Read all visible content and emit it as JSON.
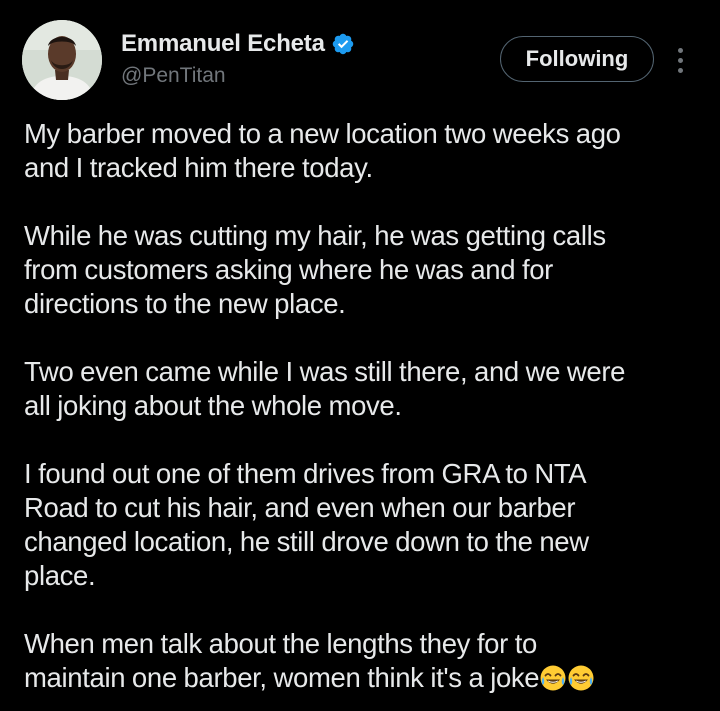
{
  "author": {
    "display_name": "Emmanuel Echeta",
    "handle": "@PenTitan",
    "verified": true,
    "avatar_icon": "profile-photo"
  },
  "actions": {
    "follow_label": "Following",
    "more_icon": "more-vertical-icon"
  },
  "tweet": {
    "paragraphs": [
      [
        "My barber moved to a new location two weeks ago",
        "and I tracked him there today."
      ],
      [
        "While he was cutting my hair, he was getting calls",
        "from customers asking where he was and for",
        "directions to the new place."
      ],
      [
        "Two even came while I was still there, and we were",
        "all joking about the whole move."
      ],
      [
        "I found out one of them drives from GRA to NTA",
        "Road to cut his hair, and even when our barber",
        "changed location, he still drove down to the new",
        "place."
      ],
      [
        "When men talk about the lengths they for to",
        "maintain one barber, women think it's a joke"
      ]
    ],
    "trailing_emoji": "face-with-tears-of-joy-icon",
    "trailing_emoji_count": 2
  },
  "colors": {
    "background": "#000000",
    "text_primary": "#e7e9ea",
    "text_secondary": "#71767b",
    "verified_blue": "#1d9bf0",
    "button_border": "#536471"
  }
}
